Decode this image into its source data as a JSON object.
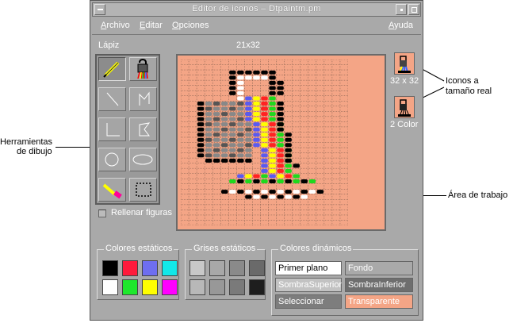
{
  "window": {
    "title": "Editor de iconos – Dtpaintm.pm"
  },
  "menubar": {
    "items": [
      "Archivo",
      "Editar",
      "Opciones"
    ],
    "help": "Ayuda"
  },
  "toolbar_info": {
    "tool_name": "Lápiz",
    "size": "21x32"
  },
  "tools": [
    {
      "name": "pencil-tool-icon"
    },
    {
      "name": "paint-bucket-tool-icon"
    },
    {
      "name": "line-tool-icon"
    },
    {
      "name": "polyline-tool-icon"
    },
    {
      "name": "rectangle-tool-icon"
    },
    {
      "name": "polygon-tool-icon"
    },
    {
      "name": "circle-tool-icon"
    },
    {
      "name": "ellipse-tool-icon"
    },
    {
      "name": "eraser-tool-icon"
    },
    {
      "name": "select-tool-icon"
    }
  ],
  "fill_shapes": {
    "label": "Rellenar figuras",
    "checked": false
  },
  "previews": {
    "size_label": "32 x 32",
    "color_label": "2 Color"
  },
  "static_colors": {
    "label": "Colores estáticos",
    "swatches": [
      "#000000",
      "#ff1a3c",
      "#6e6ef0",
      "#12e8e8",
      "#ffffff",
      "#1ee82c",
      "#ffff00",
      "#ff00ff"
    ]
  },
  "static_grays": {
    "label": "Grises estáticos",
    "swatches": [
      "#c8c8c8",
      "#a8a8a8",
      "#8a8a8a",
      "#6a6a6a",
      "#b8b8b8",
      "#989898",
      "#7a7a7a",
      "#1e1e1e"
    ]
  },
  "dynamic_colors": {
    "label": "Colores dinámicos",
    "buttons": [
      {
        "label": "Primer plano",
        "bg": "#ffffff",
        "fg": "#000000"
      },
      {
        "label": "Fondo",
        "bg": "#a9a9a9",
        "fg": "#ffffff"
      },
      {
        "label": "SombraSuperior",
        "bg": "#c2c2c2",
        "fg": "#ffffff"
      },
      {
        "label": "SombraInferior",
        "bg": "#6e6e6e",
        "fg": "#ffffff"
      },
      {
        "label": "Seleccionar",
        "bg": "#7d7d7d",
        "fg": "#ffffff"
      },
      {
        "label": "Transparente",
        "bg": "#f4a586",
        "fg": "#ffffff"
      }
    ]
  },
  "annotations": {
    "tools_line1": "Herramientas",
    "tools_line2": "de dibujo",
    "icons_line1": "Iconos a",
    "icons_line2": "tamaño real",
    "work_area": "Área de trabajo"
  },
  "colors": {
    "canvas_bg": "#f4a586",
    "window_bg": "#a9a9a9"
  }
}
